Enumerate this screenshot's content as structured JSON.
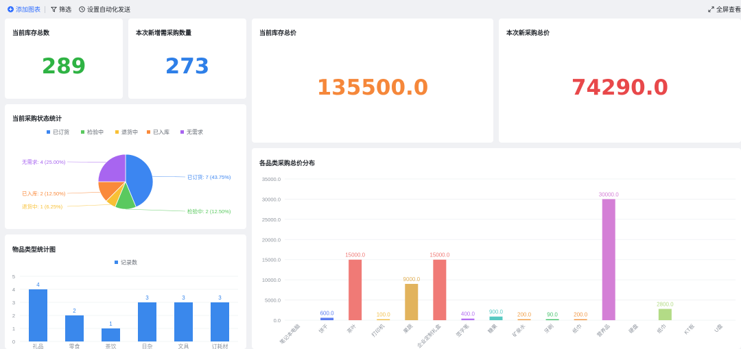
{
  "toolbar": {
    "add_chart": "添加图表",
    "filter": "筛选",
    "auto_send": "设置自动化发送",
    "fullscreen": "全屏查看"
  },
  "colors": {
    "primary": "#3370ff",
    "green": "#2fb344",
    "blue": "#2e7fe8",
    "orange": "#f5873a",
    "red": "#e8484a"
  },
  "kpis": {
    "stock_total": {
      "title": "当前库存总数",
      "value": "289",
      "color": "#2fb344"
    },
    "new_purchase_qty": {
      "title": "本次新增需采购数量",
      "value": "273",
      "color": "#2e7fe8"
    },
    "stock_value": {
      "title": "当前库存总价",
      "value": "135500.0",
      "color": "#f5873a"
    },
    "new_purchase_value": {
      "title": "本次新采购总价",
      "value": "74290.0",
      "color": "#e8484a"
    }
  },
  "charts": {
    "status_pie": {
      "title": "当前采购状态统计",
      "chart_data": {
        "type": "pie",
        "legend_position": "top",
        "slices": [
          {
            "name": "已订货",
            "value": 7,
            "label": "已订货: 7 (43.75%)",
            "color": "#3c86f1"
          },
          {
            "name": "检验中",
            "value": 2,
            "label": "检验中: 2 (12.50%)",
            "color": "#5ac95f"
          },
          {
            "name": "退货中",
            "value": 1,
            "label": "退货中: 1 (6.25%)",
            "color": "#f8c035"
          },
          {
            "name": "已入库",
            "value": 2,
            "label": "已入库: 2 (12.50%)",
            "color": "#fa8a3b"
          },
          {
            "name": "无需求",
            "value": 4,
            "label": "无需求: 4 (25.00%)",
            "color": "#a865f0"
          }
        ]
      }
    },
    "type_bar": {
      "title": "物品类型统计图",
      "chart_data": {
        "type": "bar",
        "legend_position": "top",
        "series": [
          {
            "name": "记录数",
            "color": "#3a88ec",
            "values": [
              4,
              2,
              1,
              3,
              3,
              3
            ]
          }
        ],
        "categories": [
          "礼品",
          "零食",
          "茶饮",
          "日杂",
          "文具",
          "订耗材"
        ],
        "ylim": [
          0,
          5
        ],
        "yticks": [
          "0",
          "1",
          "2",
          "3",
          "4",
          "5"
        ],
        "value_labels": [
          "4",
          "2",
          "1",
          "3",
          "3",
          "3"
        ],
        "grid": true
      }
    },
    "price_bar": {
      "title": "各品类采购总价分布",
      "chart_data": {
        "type": "bar",
        "categories": [
          "笔记本电脑",
          "饼干",
          "茶叶",
          "打印机",
          "果蔬",
          "企业定制礼盒",
          "签字笔",
          "糖果",
          "矿泉水",
          "牙刷",
          "纸巾",
          "营养品",
          "硬盘",
          "纸巾",
          "KT板",
          "U盘"
        ],
        "values": [
          0,
          600,
          15000,
          100,
          9000,
          15000,
          400,
          900,
          200,
          90,
          200,
          30000,
          0,
          2800,
          0,
          0
        ],
        "value_labels": [
          "",
          "600.0",
          "15000.0",
          "100.0",
          "9000.0",
          "15000.0",
          "400.0",
          "900.0",
          "200.0",
          "90.0",
          "200.0",
          "30000.0",
          "",
          "2800.0",
          "",
          ""
        ],
        "colors": [
          "#5b7cf0",
          "#5b7cf0",
          "#f07a76",
          "#f2c14e",
          "#e2b35c",
          "#f07a76",
          "#b46ff2",
          "#57c9c2",
          "#f2a14a",
          "#4cc470",
          "#f29a4a",
          "#d47fd6",
          "#9aa6b8",
          "#b3db86",
          "#8c9ab0",
          "#8c9ab0"
        ],
        "ylim": [
          0,
          35000
        ],
        "yticks": [
          "0.0",
          "5000.0",
          "10000.0",
          "15000.0",
          "20000.0",
          "25000.0",
          "30000.0",
          "35000.0"
        ],
        "grid": true
      }
    }
  }
}
